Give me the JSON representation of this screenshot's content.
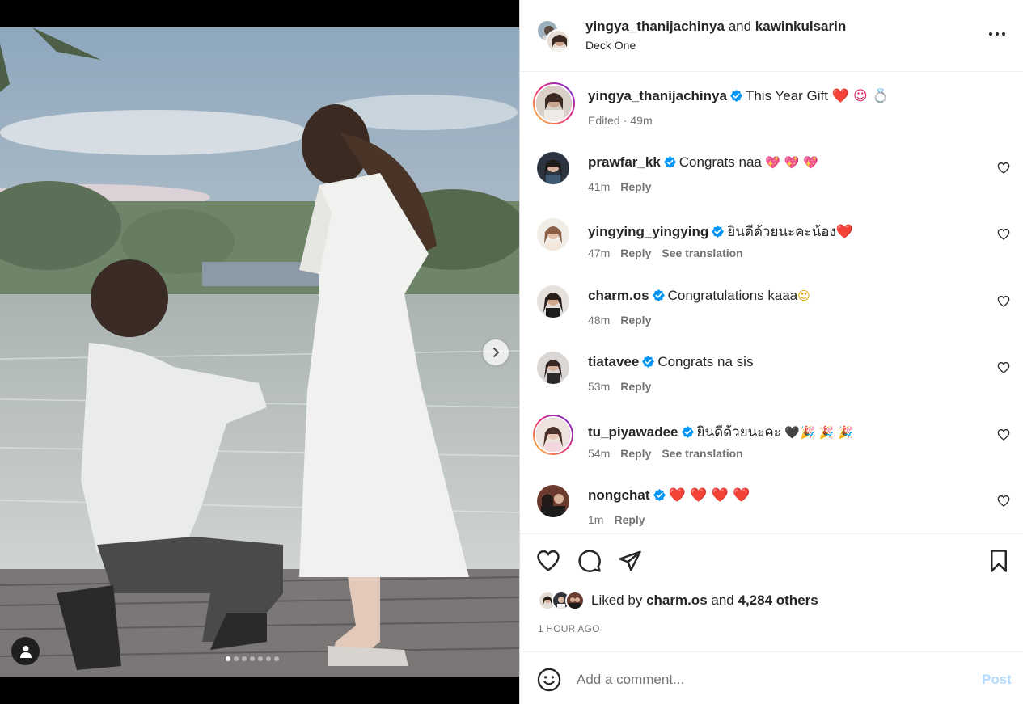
{
  "header": {
    "owner": "yingya_thanijachinya",
    "joiner": "and",
    "collaborator": "kawinkulsarin",
    "location": "Deck One"
  },
  "caption": {
    "username": "yingya_thanijachinya",
    "text": "This Year Gift",
    "emoji": "❤️ ☺ 💍",
    "edited": "Edited",
    "sep": "·",
    "time": "49m"
  },
  "comments": [
    {
      "username": "prawfar_kk",
      "text": "Congrats naa",
      "emoji": "💖 💖 💖",
      "time": "41m",
      "reply": "Reply",
      "translate": ""
    },
    {
      "username": "yingying_yingying",
      "text": "ยินดีด้วยนะคะน้อง",
      "emoji": "❤️",
      "time": "47m",
      "reply": "Reply",
      "translate": "See translation"
    },
    {
      "username": "charm.os",
      "text": "Congratulations kaaa",
      "emoji": "😍",
      "time": "48m",
      "reply": "Reply",
      "translate": ""
    },
    {
      "username": "tiatavee",
      "text": "Congrats na sis",
      "emoji": "",
      "time": "53m",
      "reply": "Reply",
      "translate": ""
    },
    {
      "username": "tu_piyawadee",
      "text": "ยินดีด้วยนะคะ",
      "emoji": "🖤🎉 🎉 🎉",
      "time": "54m",
      "reply": "Reply",
      "translate": "See translation"
    },
    {
      "username": "nongchat",
      "text": "",
      "emoji": "❤️ ❤️ ❤️ ❤️",
      "time": "1m",
      "reply": "Reply",
      "translate": ""
    }
  ],
  "likes": {
    "prefix": "Liked by",
    "user": "charm.os",
    "joiner": "and",
    "others": "4,284 others"
  },
  "timestamp": "1 HOUR AGO",
  "add_comment": {
    "placeholder": "Add a comment...",
    "post_label": "Post"
  },
  "carousel": {
    "total": 7,
    "active": 1
  },
  "colors": {
    "verified": "#0095f6",
    "post_disabled": "#b3dbff",
    "heart_red": "#e0245e",
    "muted": "#737373"
  },
  "icons": [
    "more-icon",
    "verified-icon",
    "like-icon",
    "comment-icon",
    "share-icon",
    "save-icon",
    "emoji-icon",
    "chevron-right-icon",
    "user-tag-icon"
  ]
}
